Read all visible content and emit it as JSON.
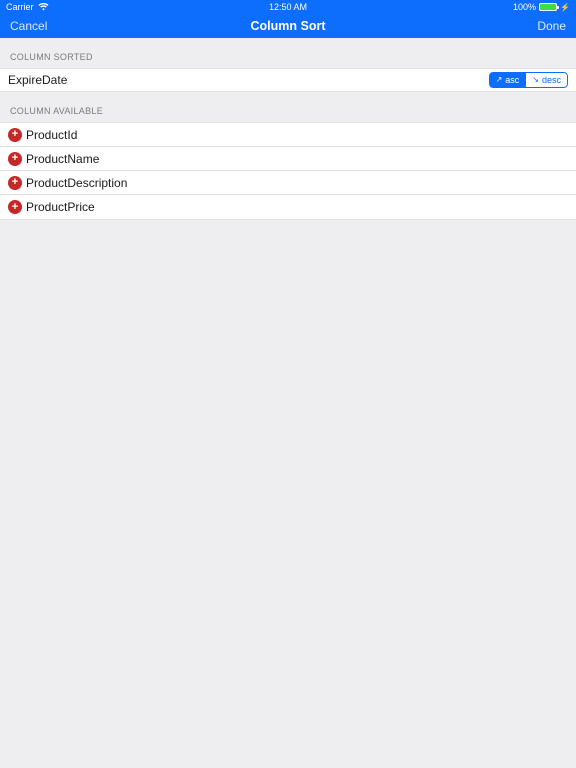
{
  "status": {
    "carrier": "Carrier",
    "time": "12:50 AM",
    "battery_pct": "100%"
  },
  "nav": {
    "cancel": "Cancel",
    "title": "Column Sort",
    "done": "Done"
  },
  "sorted_section": {
    "header": "COLUMN SORTED",
    "rows": [
      {
        "label": "ExpireDate",
        "asc": "asc",
        "desc": "desc",
        "active": "asc"
      }
    ]
  },
  "available_section": {
    "header": "COLUMN AVAILABLE",
    "rows": [
      {
        "label": "ProductId"
      },
      {
        "label": "ProductName"
      },
      {
        "label": "ProductDescription"
      },
      {
        "label": "ProductPrice"
      }
    ]
  }
}
